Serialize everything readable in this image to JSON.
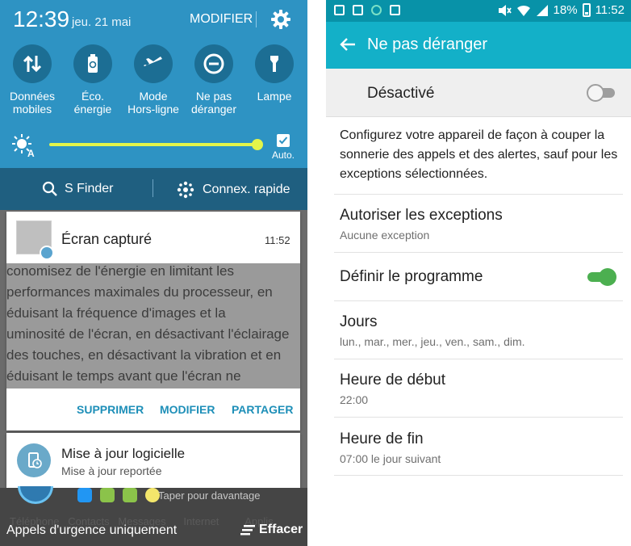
{
  "left": {
    "clock": "12:39",
    "date": "jeu. 21 mai",
    "modifier": "MODIFIER",
    "tiles": [
      {
        "label": "Données\nmobiles",
        "icon": "data-arrows-icon"
      },
      {
        "label": "Éco.\nénergie",
        "icon": "battery-recycle-icon"
      },
      {
        "label": "Mode\nHors-ligne",
        "icon": "airplane-icon"
      },
      {
        "label": "Ne pas\ndéranger",
        "icon": "minus-circle-icon"
      },
      {
        "label": "Lampe",
        "icon": "flashlight-icon"
      }
    ],
    "brightness": {
      "auto_label": "Auto.",
      "level_percent": 100
    },
    "finder": "S Finder",
    "connex": "Connex. rapide",
    "notification1": {
      "title": "Écran capturé",
      "time": "11:52",
      "preview": "conomisez de l'énergie en limitant les\nperformances maximales du processeur, en\néduisant la fréquence d'images et la\numinosité de l'écran, en désactivant l'éclairage\ndes touches, en désactivant la vibration et en\néduisant le temps avant que l'écran ne",
      "actions": [
        "SUPPRIMER",
        "MODIFIER",
        "PARTAGER"
      ]
    },
    "notification2": {
      "title": "Mise à jour logicielle",
      "subtitle": "Mise à jour reportée"
    },
    "taper": "Taper pour davantage",
    "dock_labels": "Téléphone   Contacts   Messages      Internet         Applis",
    "urgence": "Appels d'urgence uniquement",
    "effacer": "Effacer"
  },
  "right": {
    "status": {
      "battery": "18%",
      "time": "11:52"
    },
    "title": "Ne pas déranger",
    "master": {
      "label": "Désactivé",
      "on": false
    },
    "description": "Configurez votre appareil de façon à couper la sonnerie des appels et des alertes, sauf pour les exceptions sélectionnées.",
    "exceptions": {
      "title": "Autoriser les exceptions",
      "subtitle": "Aucune exception"
    },
    "schedule": {
      "title": "Définir le programme",
      "on": true
    },
    "days": {
      "title": "Jours",
      "subtitle": "lun., mar., mer., jeu., ven., sam., dim."
    },
    "start": {
      "title": "Heure de début",
      "subtitle": "22:00"
    },
    "end": {
      "title": "Heure de fin",
      "subtitle": "07:00 le jour suivant"
    }
  },
  "colors": {
    "quick_panel": "#2e93c3",
    "slider": "#e3f54a",
    "action_text": "#1e8fb8",
    "app_bar": "#13b0c8",
    "toggle_on": "#4caf50"
  }
}
